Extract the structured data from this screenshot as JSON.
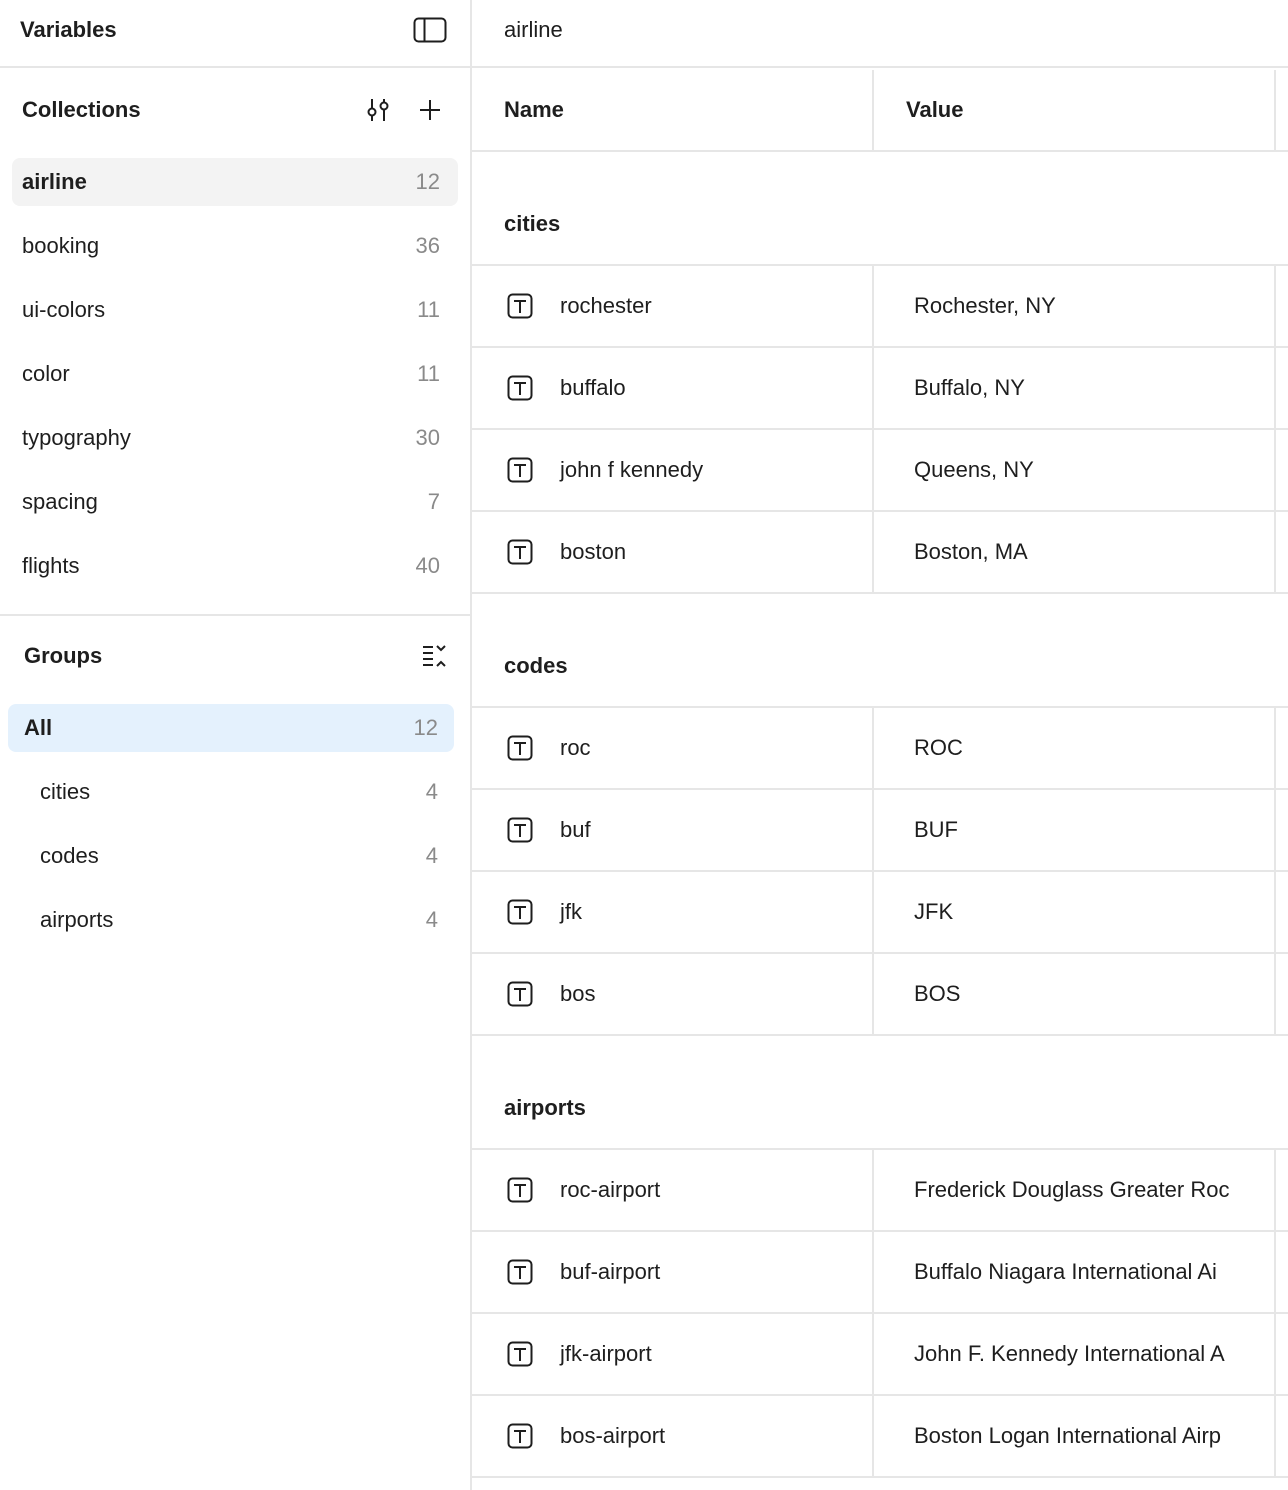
{
  "sidebar": {
    "title": "Variables",
    "collections": {
      "title": "Collections",
      "items": [
        {
          "label": "airline",
          "count": "12"
        },
        {
          "label": "booking",
          "count": "36"
        },
        {
          "label": "ui-colors",
          "count": "11"
        },
        {
          "label": "color",
          "count": "11"
        },
        {
          "label": "typography",
          "count": "30"
        },
        {
          "label": "spacing",
          "count": "7"
        },
        {
          "label": "flights",
          "count": "40"
        }
      ]
    },
    "groups": {
      "title": "Groups",
      "items": [
        {
          "label": "All",
          "count": "12"
        },
        {
          "label": "cities",
          "count": "4"
        },
        {
          "label": "codes",
          "count": "4"
        },
        {
          "label": "airports",
          "count": "4"
        }
      ]
    }
  },
  "main": {
    "title": "airline",
    "columns": {
      "name": "Name",
      "value": "Value"
    },
    "groups": [
      {
        "label": "cities",
        "rows": [
          {
            "name": "rochester",
            "value": "Rochester, NY"
          },
          {
            "name": "buffalo",
            "value": "Buffalo, NY"
          },
          {
            "name": "john f kennedy",
            "value": "Queens, NY"
          },
          {
            "name": "boston",
            "value": "Boston, MA"
          }
        ]
      },
      {
        "label": "codes",
        "rows": [
          {
            "name": "roc",
            "value": "ROC"
          },
          {
            "name": "buf",
            "value": "BUF"
          },
          {
            "name": "jfk",
            "value": "JFK"
          },
          {
            "name": "bos",
            "value": "BOS"
          }
        ]
      },
      {
        "label": "airports",
        "rows": [
          {
            "name": "roc-airport",
            "value": "Frederick Douglass Greater Roc"
          },
          {
            "name": "buf-airport",
            "value": "Buffalo Niagara International Ai"
          },
          {
            "name": "jfk-airport",
            "value": "John F. Kennedy International A"
          },
          {
            "name": "bos-airport",
            "value": "Boston Logan International Airp"
          }
        ]
      }
    ]
  },
  "icons": {
    "panel_toggle": "sidebar-panel-icon",
    "filter": "sliders-icon",
    "add": "plus-icon",
    "collapse": "collapse-list-icon",
    "variable_type": "text-type-icon"
  }
}
